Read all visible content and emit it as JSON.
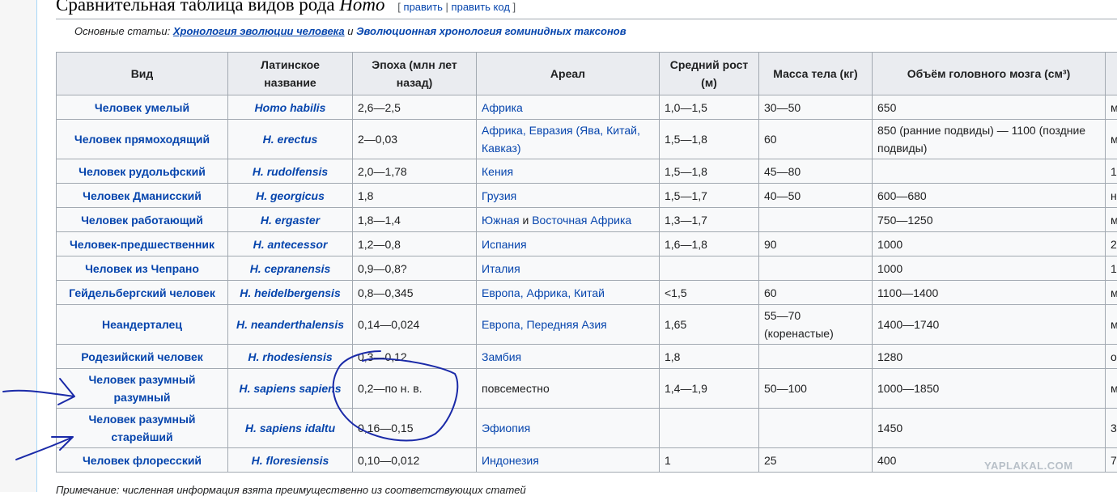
{
  "heading": {
    "text": "Сравнительная таблица видов рода ",
    "italic": "Homo",
    "edit_open": "[ ",
    "edit1": "править",
    "edit_sep": " | ",
    "edit2": "править код",
    "edit_close": " ]"
  },
  "hatnote": {
    "prefix": "Основные статьи: ",
    "link1": "Хронология эволюции человека",
    "joiner": " и ",
    "link2": "Эволюционная хронология гоминидных таксонов"
  },
  "table": {
    "headers": [
      "Вид",
      "Латинское название",
      "Эпоха (млн лет назад)",
      "Ареал",
      "Средний рост (м)",
      "Масса тела (кг)",
      "Объём головного мозга (см³)",
      ""
    ],
    "rows": [
      {
        "vid": "Человек умелый",
        "lat": "Homo habilis",
        "epoch": "2,6—2,5",
        "areal": "Африка",
        "height": "1,0—1,5",
        "mass": "30—50",
        "brain": "650",
        "extra": "м"
      },
      {
        "vid": "Человек прямоходящий",
        "lat": "H. erectus",
        "epoch": "2—0,03",
        "areal": "Африка, Евразия (Ява, Китай, Кавказ)",
        "height": "1,5—1,8",
        "mass": "60",
        "brain": "850 (ранние подвиды) — 1100 (поздние подвиды)",
        "extra": "м"
      },
      {
        "vid": "Человек рудольфский",
        "lat": "H. rudolfensis",
        "epoch": "2,0—1,78",
        "areal": "Кения",
        "height": "1,5—1,8",
        "mass": "45—80",
        "brain": "",
        "extra": "1"
      },
      {
        "vid": "Человек Дманисский",
        "lat": "H. georgicus",
        "epoch": "1,8",
        "areal": "Грузия",
        "height": "1,5—1,7",
        "mass": "40—50",
        "brain": "600—680",
        "extra": "н"
      },
      {
        "vid": "Человек работающий",
        "lat": "H. ergaster",
        "epoch": "1,8—1,4",
        "areal_a": "Южная",
        "areal_and": " и ",
        "areal_b": "Восточная Африка",
        "height": "1,3—1,7",
        "mass": "",
        "brain": "750—1250",
        "extra": "м"
      },
      {
        "vid": "Человек-предшественник",
        "lat": "H. antecessor",
        "epoch": "1,2—0,8",
        "areal": "Испания",
        "height": "1,6—1,8",
        "mass": "90",
        "brain": "1000",
        "extra": "2"
      },
      {
        "vid": "Человек из Чепрано",
        "lat": "H. cepranensis",
        "epoch": "0,9—0,8?",
        "areal": "Италия",
        "height": "",
        "mass": "",
        "brain": "1000",
        "extra": "1"
      },
      {
        "vid": "Гейдельбергский человек",
        "lat": "H. heidelbergensis",
        "epoch": "0,8—0,345",
        "areal": "Европа, Африка, Китай",
        "height": "<1,5",
        "mass": "60",
        "brain": "1100—1400",
        "extra": "м"
      },
      {
        "vid": "Неандерталец",
        "lat": "H. neanderthalensis",
        "epoch": "0,14—0,024",
        "areal": "Европа, Передняя Азия",
        "height": "1,65",
        "mass": "55—70 (коренастые)",
        "brain": "1400—1740",
        "extra": "м"
      },
      {
        "vid": "Родезийский человек",
        "lat": "H. rhodesiensis",
        "epoch": "0,3—0,12",
        "areal": "Замбия",
        "height": "1,8",
        "mass": "",
        "brain": "1280",
        "extra": "о"
      },
      {
        "vid": "Человек разумный разумный",
        "lat": "H. sapiens sapiens",
        "epoch": "0,2—по н. в.",
        "areal_plain": "повсеместно",
        "height": "1,4—1,9",
        "mass": "50—100",
        "brain": "1000—1850",
        "extra": "м"
      },
      {
        "vid": "Человек разумный старейший",
        "lat": "H. sapiens idaltu",
        "epoch": "0,16—0,15",
        "areal": "Эфиопия",
        "height": "",
        "mass": "",
        "brain": "1450",
        "extra": "3"
      },
      {
        "vid": "Человек флоресский",
        "lat": "H. floresiensis",
        "epoch": "0,10—0,012",
        "areal": "Индонезия",
        "height": "1",
        "mass": "25",
        "brain": "400",
        "extra": "7"
      }
    ]
  },
  "watermark": "YAPLAKAL.COM",
  "footnote": "Примечание: численная информация взята преимущественно из соответствующих статей",
  "annotation_color": "#1a2aa8"
}
